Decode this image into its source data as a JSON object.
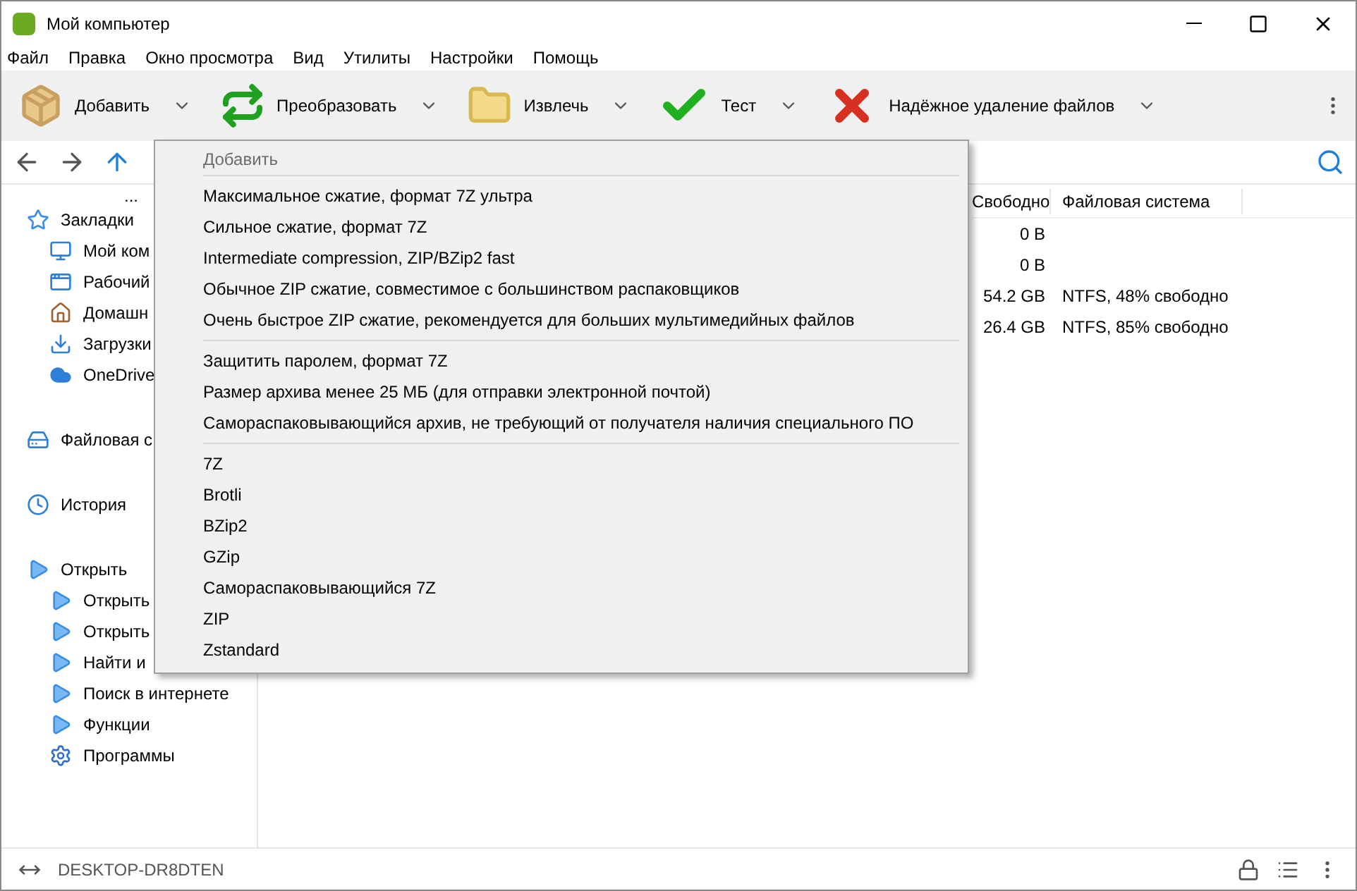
{
  "window": {
    "title": "Мой компьютер"
  },
  "menubar": [
    "Файл",
    "Правка",
    "Окно просмотра",
    "Вид",
    "Утилиты",
    "Настройки",
    "Помощь"
  ],
  "toolbar": [
    {
      "kind": "add",
      "label": "Добавить"
    },
    {
      "kind": "convert",
      "label": "Преобразовать"
    },
    {
      "kind": "extract",
      "label": "Извлечь"
    },
    {
      "kind": "test",
      "label": "Тест"
    },
    {
      "kind": "delete",
      "label": "Надёжное удаление файлов"
    }
  ],
  "sidebar": {
    "more": "...",
    "sections": [
      {
        "kind": "star",
        "label": "Закладки",
        "children": [
          {
            "kind": "monitor",
            "label": "Мой ком"
          },
          {
            "kind": "desktop",
            "label": "Рабочий"
          },
          {
            "kind": "home",
            "label": "Домашн"
          },
          {
            "kind": "download",
            "label": "Загрузки"
          },
          {
            "kind": "cloud",
            "label": "OneDrive"
          }
        ]
      },
      {
        "kind": "drive",
        "label": "Файловая с"
      },
      {
        "kind": "clock",
        "label": "История"
      },
      {
        "kind": "play",
        "label": "Открыть",
        "children": [
          {
            "kind": "play",
            "label": "Открыть"
          },
          {
            "kind": "play",
            "label": "Открыть"
          },
          {
            "kind": "play",
            "label": "Найти и"
          },
          {
            "kind": "play",
            "label": "Поиск в интернете"
          },
          {
            "kind": "play",
            "label": "Функции"
          },
          {
            "kind": "gear",
            "label": "Программы"
          }
        ]
      }
    ]
  },
  "table": {
    "columns": [
      "Свободно",
      "Файловая система"
    ],
    "rows": [
      [
        "0 B",
        ""
      ],
      [
        "0 B",
        ""
      ],
      [
        "54.2 GB",
        "NTFS, 48% свободно"
      ],
      [
        "26.4 GB",
        "NTFS, 85% свободно"
      ]
    ]
  },
  "menu": {
    "header": "Добавить",
    "groups": [
      [
        "Максимальное сжатие, формат 7Z ультра",
        "Сильное сжатие, формат 7Z",
        "Intermediate compression, ZIP/BZip2 fast",
        "Обычное ZIP сжатие, совместимое с большинством распаковщиков",
        "Очень быстрое ZIP сжатие, рекомендуется для больших мультимедийных файлов"
      ],
      [
        "Защитить паролем, формат 7Z",
        "Размер архива менее 25 МБ (для отправки электронной почтой)",
        "Самораспаковывающийся архив, не требующий от получателя наличия специального ПО"
      ],
      [
        "7Z",
        "Brotli",
        "BZip2",
        "GZip",
        "Самораспаковывающийся 7Z",
        "ZIP",
        "Zstandard"
      ]
    ]
  },
  "status_bar": {
    "computer": "DESKTOP-DR8DTEN"
  }
}
